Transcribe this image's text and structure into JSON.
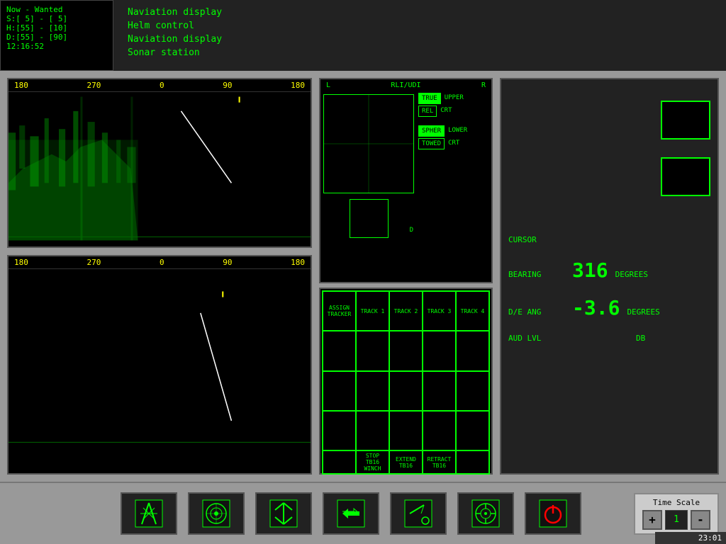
{
  "topBar": {
    "status": {
      "line1": "Now - Wanted",
      "line2": "S:[ 5] - [ 5]",
      "line3": "H:[55] - [10]",
      "line4": "D:[55] - [90]",
      "time": "12:16:52"
    },
    "nav": {
      "item1": "Naviation display",
      "item2": "Helm control",
      "item3": "Naviation display",
      "item4": "Sonar station"
    }
  },
  "sonarTop": {
    "scale": [
      "180",
      "270",
      "0",
      "90",
      "180"
    ]
  },
  "sonarBottom": {
    "scale": [
      "180",
      "270",
      "0",
      "90",
      "180"
    ]
  },
  "rli": {
    "header_left": "L",
    "header_center": "RLI/UDI",
    "header_right": "R",
    "footer": "D",
    "buttons": {
      "true_label": "TRUE",
      "rel_label": "REL",
      "upper_label": "UPPER",
      "crt_label1": "CRT",
      "spher_label": "SPHER",
      "towed_label": "TOWED",
      "lower_label": "LOWER",
      "crt_label2": "CRT"
    }
  },
  "tracker": {
    "headers": [
      "ASSIGN TRACKER",
      "TRACK 1",
      "TRACK 2",
      "TRACK 3",
      "TRACK 4"
    ],
    "bottomButtons": {
      "stop": "STOP TB16 WINCH",
      "extend": "EXTEND TB16",
      "retract": "RETRACT TB16"
    }
  },
  "readouts": {
    "cursor_label": "CURSOR",
    "bearing_label": "BEARING",
    "bearing_value": "316",
    "bearing_unit": "DEGREES",
    "de_ang_label": "D/E ANG",
    "de_ang_value": "-3.6",
    "de_ang_unit": "DEGREES",
    "aud_lvl_label": "AUD LVL",
    "aud_lvl_unit": "DB"
  },
  "timeScale": {
    "title": "Time Scale",
    "value": "1",
    "plus": "+",
    "minus": "-"
  },
  "clock": "23:01"
}
